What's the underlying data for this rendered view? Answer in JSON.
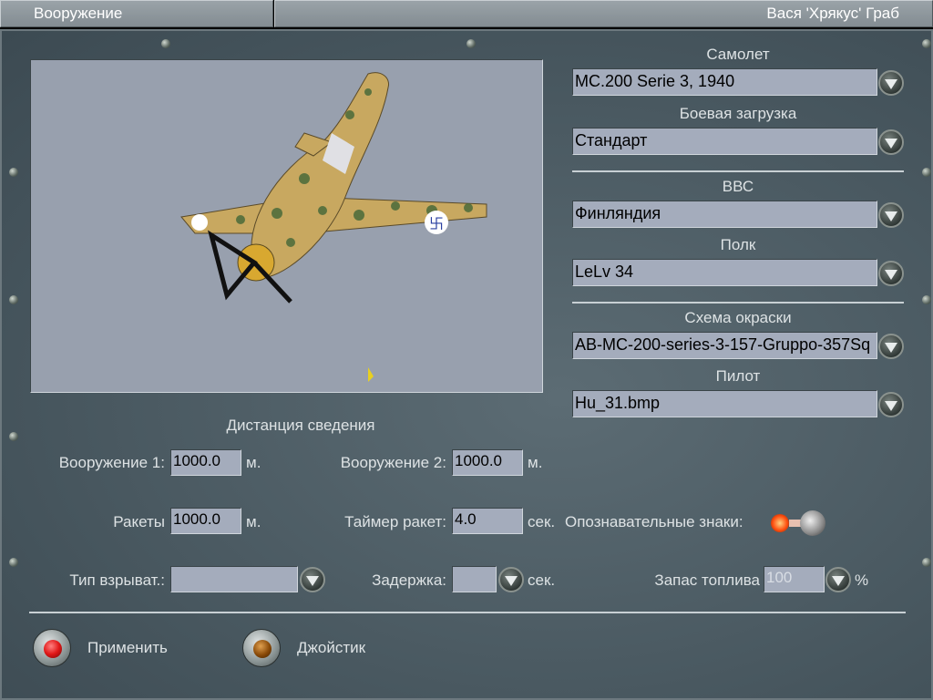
{
  "header": {
    "title": "Вооружение",
    "user": "Вася 'Хрякус' Граб"
  },
  "aircraft": {
    "label": "Самолет",
    "value": "MC.200 Serie 3, 1940"
  },
  "loadout": {
    "label": "Боевая загрузка",
    "value": "Стандарт"
  },
  "airforce": {
    "label": "ВВС",
    "value": "Финляндия"
  },
  "regiment": {
    "label": "Полк",
    "value": "LeLv 34"
  },
  "skin": {
    "label": "Схема окраски",
    "value": "AB-MC-200-series-3-157-Gruppo-357Sq"
  },
  "pilot": {
    "label": "Пилот",
    "value": "Hu_31.bmp"
  },
  "convergence": {
    "title": "Дистанция сведения",
    "weapon1_label": "Вооружение 1:",
    "weapon1_value": "1000.0",
    "weapon1_unit": "м.",
    "weapon2_label": "Вооружение 2:",
    "weapon2_value": "1000.0",
    "weapon2_unit": "м.",
    "rockets_label": "Ракеты",
    "rockets_value": "1000.0",
    "rockets_unit": "м.",
    "timer_label": "Таймер ракет:",
    "timer_value": "4.0",
    "timer_unit": "сек.",
    "markings_label": "Опознавательные знаки:",
    "fuze_label": "Тип взрыват.:",
    "fuze_value": "",
    "delay_label": "Задержка:",
    "delay_value": "",
    "delay_unit": "сек.",
    "fuel_label": "Запас топлива",
    "fuel_value": "100",
    "fuel_unit": "%"
  },
  "buttons": {
    "apply": "Применить",
    "joystick": "Джойстик"
  },
  "colors": {
    "apply_light": "#e01818",
    "joystick_light": "#8a4a08",
    "toggle_light": "#ff6020"
  }
}
